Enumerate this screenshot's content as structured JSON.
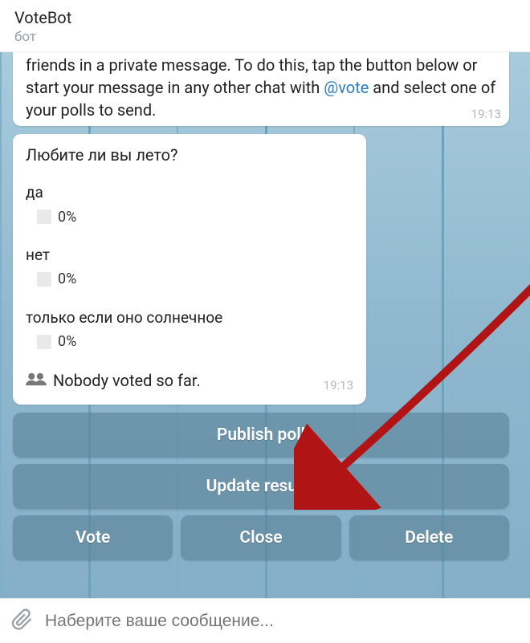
{
  "header": {
    "title": "VoteBot",
    "subtitle": "бот"
  },
  "msg1": {
    "prefix": "friends in a private message. To do this, tap the button below or start your message in any other chat with ",
    "mention": "@vote",
    "suffix": " and select one of your polls to send.",
    "time": "19:13"
  },
  "poll": {
    "question": "Любите ли вы лето?",
    "opts": [
      {
        "label": "да",
        "pct": "0%"
      },
      {
        "label": "нет",
        "pct": "0%"
      },
      {
        "label": "только если оно солнечное",
        "pct": "0%"
      }
    ],
    "status": "Nobody voted so far.",
    "time": "19:13"
  },
  "buttons": {
    "publish": "Publish poll",
    "update": "Update results",
    "vote": "Vote",
    "close": "Close",
    "delete": "Delete"
  },
  "composer": {
    "placeholder": "Наберите ваше сообщение..."
  }
}
